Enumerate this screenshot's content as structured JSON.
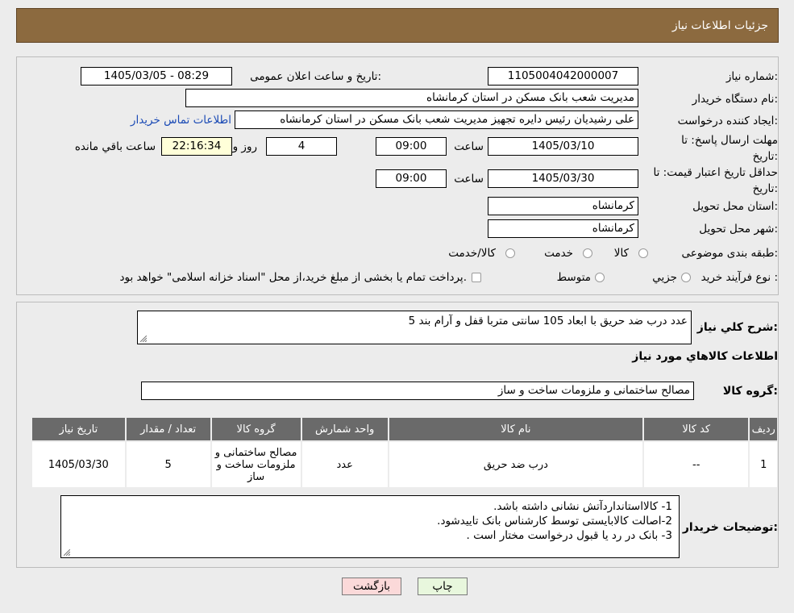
{
  "header": {
    "title": "جزئیات اطلاعات نیاز"
  },
  "form": {
    "need_number": {
      "label": "شماره نیاز:",
      "value": "1105004042000007"
    },
    "announce_datetime": {
      "label": "تاریخ و ساعت اعلان عمومی:",
      "value": "1405/03/05 - 08:29"
    },
    "buyer_org": {
      "label": "نام دستگاه خریدار:",
      "value": "مدیریت شعب بانک مسکن در استان کرمانشاه"
    },
    "requester": {
      "label": "ایجاد کننده درخواست:",
      "value": "علی رشیدیان رئیس دایره تجهیز  مدیریت شعب بانک مسکن در استان کرمانشاه",
      "contact_link": "اطلاعات تماس خریدار"
    },
    "reply_deadline": {
      "label": "مهلت ارسال پاسخ: تا تاریخ:",
      "date": "1405/03/10",
      "time_label": "ساعت",
      "time": "09:00",
      "days": "4",
      "days_label": "روز و",
      "remaining": "22:16:34",
      "remaining_label": "ساعت باقي مانده"
    },
    "price_validity": {
      "label": "حداقل تاریخ اعتبار قیمت: تا تاریخ:",
      "date": "1405/03/30",
      "time_label": "ساعت",
      "time": "09:00"
    },
    "delivery_province": {
      "label": "استان محل تحویل:",
      "value": "کرمانشاه"
    },
    "delivery_city": {
      "label": "شهر محل تحویل:",
      "value": "کرمانشاه"
    },
    "category": {
      "label": "طبقه بندی موضوعی:",
      "options": [
        "کالا",
        "خدمت",
        "کالا/خدمت"
      ]
    },
    "purchase_type": {
      "label": "نوع فرآیند خرید :",
      "options": [
        "جزیي",
        "متوسط"
      ],
      "note": "پرداخت تمام یا بخشی از مبلغ خرید،از محل \"اسناد خزانه اسلامی\" خواهد بود."
    }
  },
  "summary": {
    "label": "شرح کلي نياز:",
    "value": "5 عدد درب ضد حریق با ابعاد 105 سانتی متربا قفل و آرام بند",
    "goods_info_title": "اطلاعات کالاهاي مورد نياز",
    "goods_group_label": "گروه کالا:",
    "goods_group_value": "مصالح ساختمانی و ملزومات ساخت و ساز"
  },
  "table": {
    "headers": [
      "ردیف",
      "کد کالا",
      "نام کالا",
      "واحد شمارش",
      "گروه کالا",
      "تعداد / مقدار",
      "تاریخ نیاز"
    ],
    "rows": [
      [
        "1",
        "--",
        "درب ضد حریق",
        "عدد",
        "مصالح ساختمانی و ملزومات ساخت و ساز",
        "5",
        "1405/03/30"
      ]
    ]
  },
  "buyer_notes": {
    "label": "توضیحات خریدار:",
    "lines": [
      "1- کالااستانداردآتش نشانی داشته باشد.",
      "2-اصالت کالابایستی توسط کارشناس بانک تاییدشود.",
      "3- بانک در رد یا قبول درخواست مختار است ."
    ]
  },
  "buttons": {
    "print": "چاپ",
    "back": "بازگشت"
  },
  "colors": {
    "header_bg": "#8c6a3f",
    "table_header_bg": "#6a6a6a",
    "back_button_bg": "#fbd9d9",
    "print_button_bg": "#e8f7dd",
    "link": "#1a4ab5",
    "remaining_bg": "#ffffd9"
  }
}
